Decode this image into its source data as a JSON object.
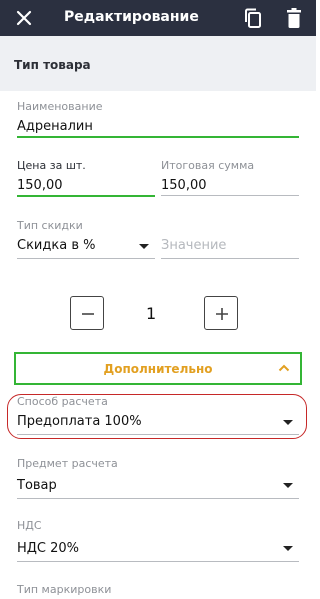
{
  "header": {
    "title": "Редактирование",
    "close_icon": "close-icon",
    "copy_icon": "copy-icon",
    "trash_icon": "trash-icon"
  },
  "section": {
    "title": "Тип товара"
  },
  "form": {
    "name": {
      "label": "Наименование",
      "value": "Адреналин"
    },
    "price": {
      "label": "Цена за шт.",
      "value": "150,00"
    },
    "total": {
      "label": "Итоговая сумма",
      "value": "150,00"
    },
    "discount_type": {
      "label": "Тип скидки",
      "value": "Скидка в %"
    },
    "discount_value": {
      "placeholder": "Значение"
    },
    "quantity": {
      "value": "1"
    },
    "more_button": {
      "label": "Дополнительно"
    },
    "payment_method": {
      "label": "Способ расчета",
      "value": "Предоплата 100%"
    },
    "payment_subject": {
      "label": "Предмет расчета",
      "value": "Товар"
    },
    "vat": {
      "label": "НДС",
      "value": "НДС 20%"
    },
    "marking_type": {
      "label": "Тип маркировки"
    }
  },
  "colors": {
    "header_bg": "#2b3040",
    "accent_green": "#34b535",
    "accent_orange": "#e2a021",
    "highlight_red": "#c62828"
  }
}
